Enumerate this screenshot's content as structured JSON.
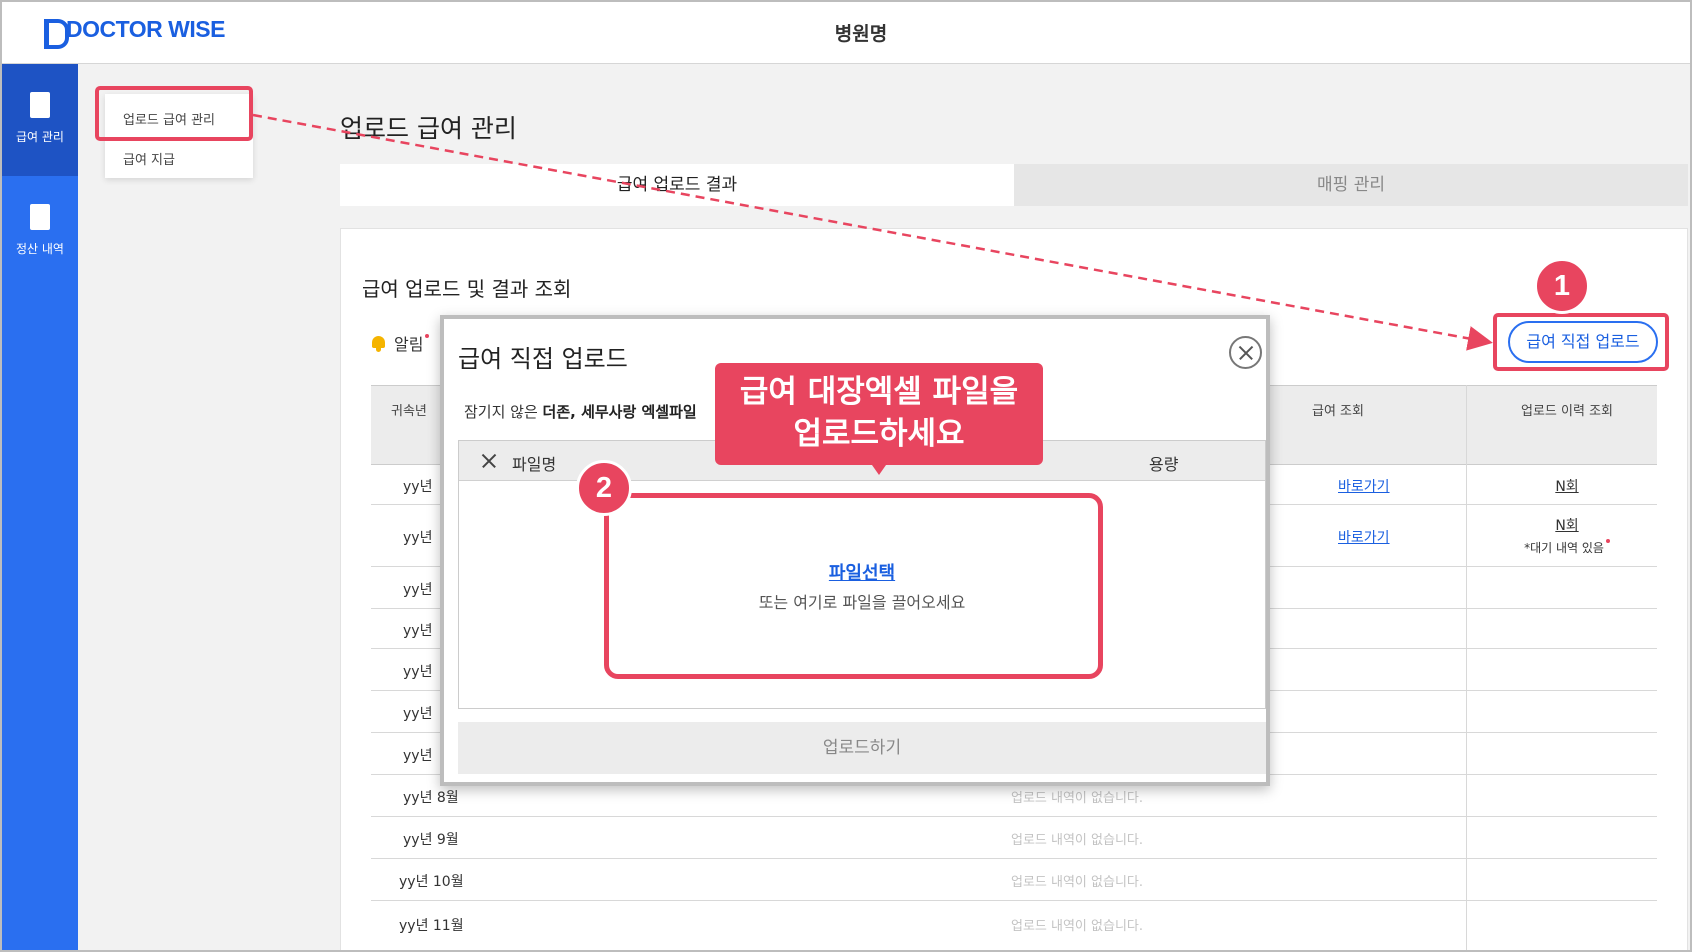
{
  "header": {
    "logo_text": "DOCTOR WISE",
    "hospital_name": "병원명"
  },
  "sidenav": {
    "items": [
      {
        "label": "급여 관리",
        "icon": "document-icon",
        "active": true
      },
      {
        "label": "정산 내역",
        "icon": "document-icon",
        "active": false
      }
    ]
  },
  "submenu": {
    "items": [
      {
        "label": "업로드 급여 관리"
      },
      {
        "label": "급여 지급"
      }
    ]
  },
  "page": {
    "title": "업로드 급여 관리",
    "tabs": [
      {
        "label": "급여 업로드 결과",
        "active": true
      },
      {
        "label": "매핑 관리",
        "active": false
      }
    ],
    "section_title": "급여 업로드 및 결과 조회",
    "alert_label": "알림",
    "upload_button": "급여 직접 업로드"
  },
  "table": {
    "headers": {
      "affiliation": "귀속년",
      "salary_view": "급여 조회",
      "upload_history": "업로드 이력 조회"
    },
    "rows": [
      {
        "month": "yy년",
        "link": "바로가기",
        "count": "N회",
        "pending": ""
      },
      {
        "month": "yy년",
        "link": "바로가기",
        "count": "N회",
        "pending": "*대기 내역 있음"
      },
      {
        "month": "yy년"
      },
      {
        "month": "yy년"
      },
      {
        "month": "yy년"
      },
      {
        "month": "yy년"
      },
      {
        "month": "yy년"
      },
      {
        "month": "yy년 8월",
        "empty": "업로드 내역이 없습니다."
      },
      {
        "month": "yy년 9월",
        "empty": "업로드 내역이 없습니다."
      },
      {
        "month": "yy년 10월",
        "empty": "업로드 내역이 없습니다."
      },
      {
        "month": "yy년 11월",
        "empty": "업로드 내역이 없습니다."
      }
    ]
  },
  "modal": {
    "title": "급여 직접 업로드",
    "desc_prefix": "잠기지 않은 ",
    "desc_bold": "더존, 세무사랑 엑셀파일",
    "col_filename": "파일명",
    "col_size": "용량",
    "file_select": "파일선택",
    "drop_hint": "또는 여기로 파일을 끌어오세요",
    "submit": "업로드하기"
  },
  "annotations": {
    "callout_line1": "급여 대장엑셀 파일을",
    "callout_line2": "업로드하세요",
    "badge1": "1",
    "badge2": "2",
    "accent_color": "#e8455f",
    "brand_color": "#2a6ff0"
  }
}
